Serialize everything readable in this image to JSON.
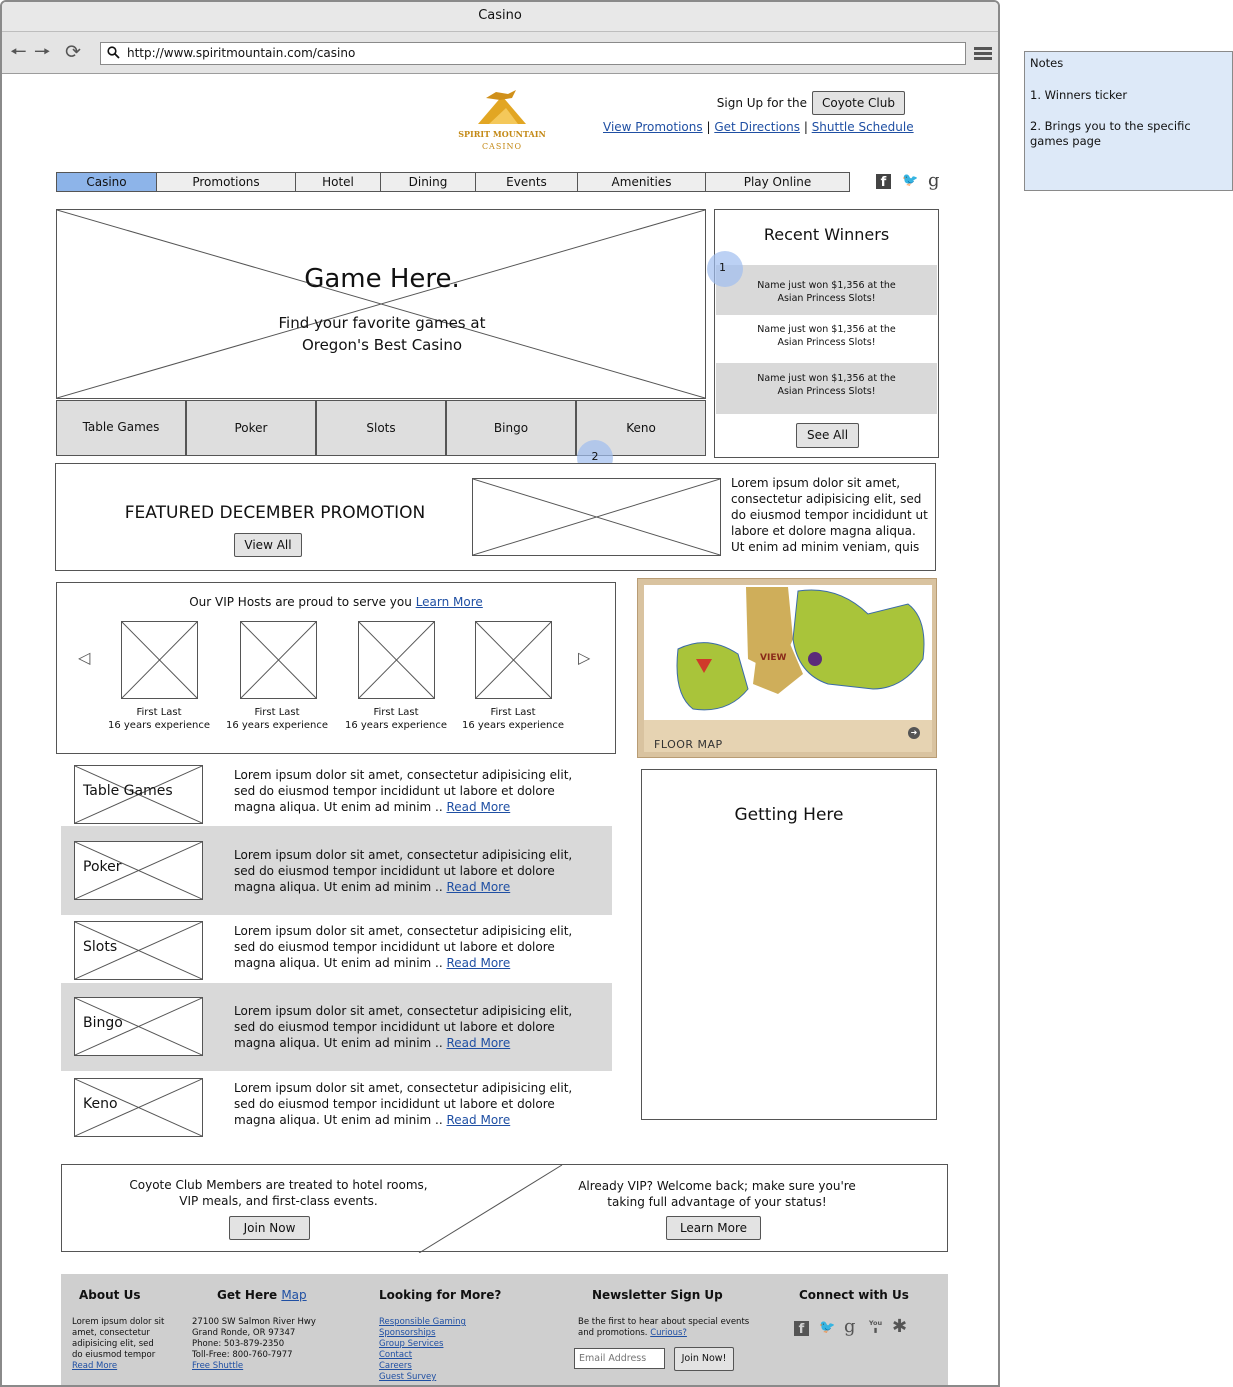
{
  "window": {
    "title": "Casino"
  },
  "browser": {
    "url": "http://www.spiritmountain.com/casino"
  },
  "header": {
    "logo_line1": "SPIRIT MOUNTAIN",
    "logo_line2": "CASINO",
    "signup_prefix": "Sign Up for the",
    "coyote_club_button": "Coyote Club",
    "links": [
      "View Promotions",
      "Get Directions",
      "Shuttle Schedule"
    ],
    "separator": "|"
  },
  "nav": {
    "items": [
      "Casino",
      "Promotions",
      "Hotel",
      "Dining",
      "Events",
      "Amenities",
      "Play Online"
    ],
    "active": "Casino"
  },
  "hero": {
    "title": "Game Here.",
    "subtitle_line1": "Find your favorite games at",
    "subtitle_line2": "Oregon's Best Casino"
  },
  "game_tabs": [
    "Table Games",
    "Poker",
    "Slots",
    "Bingo",
    "Keno"
  ],
  "winners": {
    "title": "Recent Winners",
    "rows": [
      {
        "line1": "Name just won $1,356 at the",
        "line2": "Asian Princess Slots!"
      },
      {
        "line1": "Name just won $1,356 at the",
        "line2": "Asian Princess Slots!"
      },
      {
        "line1": "Name just won $1,356 at the",
        "line2": "Asian Princess Slots!"
      }
    ],
    "see_all": "See All"
  },
  "annotations": [
    "1",
    "2"
  ],
  "promotion": {
    "title": "FEATURED DECEMBER PROMOTION",
    "view_all": "View All",
    "text_lines": [
      "Lorem ipsum dolor sit amet,",
      "consectetur adipisicing elit, sed",
      "do eiusmod tempor incididunt ut",
      "labore et dolore magna aliqua.",
      "Ut enim ad minim veniam, quis"
    ]
  },
  "vip": {
    "intro": "Our VIP Hosts are proud to serve you",
    "learn_more": "Learn More",
    "hosts": [
      {
        "name": "First Last",
        "experience": "16 years experience"
      },
      {
        "name": "First Last",
        "experience": "16 years experience"
      },
      {
        "name": "First Last",
        "experience": "16 years experience"
      },
      {
        "name": "First Last",
        "experience": "16 years experience"
      }
    ]
  },
  "floor_map": {
    "label": "FLOOR MAP",
    "center_label": "VIEW"
  },
  "games": [
    {
      "name": "Table Games",
      "lines": [
        "Lorem ipsum dolor sit amet, consectetur adipisicing elit,",
        "sed do eiusmod tempor incididunt ut labore et dolore",
        "magna aliqua. Ut enim ad minim .."
      ],
      "read_more": "Read More"
    },
    {
      "name": "Poker",
      "lines": [
        "Lorem ipsum dolor sit amet, consectetur adipisicing elit,",
        "sed do eiusmod tempor incididunt ut labore et dolore",
        "magna aliqua. Ut enim ad minim .."
      ],
      "read_more": "Read More"
    },
    {
      "name": "Slots",
      "lines": [
        "Lorem ipsum dolor sit amet, consectetur adipisicing elit,",
        "sed do eiusmod tempor incididunt ut labore et dolore",
        "magna aliqua. Ut enim ad minim .."
      ],
      "read_more": "Read More"
    },
    {
      "name": "Bingo",
      "lines": [
        "Lorem ipsum dolor sit amet, consectetur adipisicing elit,",
        "sed do eiusmod tempor incididunt ut labore et dolore",
        "magna aliqua. Ut enim ad minim .."
      ],
      "read_more": "Read More"
    },
    {
      "name": "Keno",
      "lines": [
        "Lorem ipsum dolor sit amet, consectetur adipisicing elit,",
        "sed do eiusmod tempor incididunt ut labore et dolore",
        "magna aliqua. Ut enim ad minim .."
      ],
      "read_more": "Read More"
    }
  ],
  "getting_here": {
    "title": "Getting Here"
  },
  "club_banner": {
    "left_line1": "Coyote Club Members are treated to hotel rooms,",
    "left_line2": "VIP meals, and first-class events.",
    "join_now": "Join Now",
    "right_line1": "Already VIP? Welcome back; make sure you're",
    "right_line2": "taking full advantage of your status!",
    "learn_more": "Learn More"
  },
  "footer": {
    "about": {
      "title": "About Us",
      "lines": [
        "Lorem ipsum dolor sit",
        "amet, consectetur",
        "adipisicing elit, sed",
        "do eiusmod tempor"
      ],
      "read_more": "Read More"
    },
    "get_here": {
      "title": "Get Here",
      "map_link": "Map",
      "lines": [
        "27100 SW Salmon River Hwy",
        "Grand Ronde, OR 97347",
        "Phone: 503-879-2350",
        "Toll-Free: 800-760-7977"
      ],
      "shuttle_link": "Free Shuttle"
    },
    "more": {
      "title": "Looking for More?",
      "links": [
        "Responsible Gaming",
        "Sponsorships",
        "Group Services",
        "Contact",
        "Careers",
        "Guest Survey"
      ]
    },
    "newsletter": {
      "title": "Newsletter Sign Up",
      "line1": "Be the first to hear about special events",
      "line2": "and promotions.",
      "curious": "Curious?",
      "placeholder": "Email Address",
      "join": "Join Now!"
    },
    "connect": {
      "title": "Connect with Us"
    }
  },
  "notes": {
    "title": "Notes",
    "items": [
      "1. Winners ticker",
      "2. Brings you to the specific games page"
    ]
  },
  "colors": {
    "nav_active": "#8db4e9",
    "link": "#1f4fa3",
    "notes_bg": "#dde9f8",
    "logo_gold": "#e2a623"
  }
}
